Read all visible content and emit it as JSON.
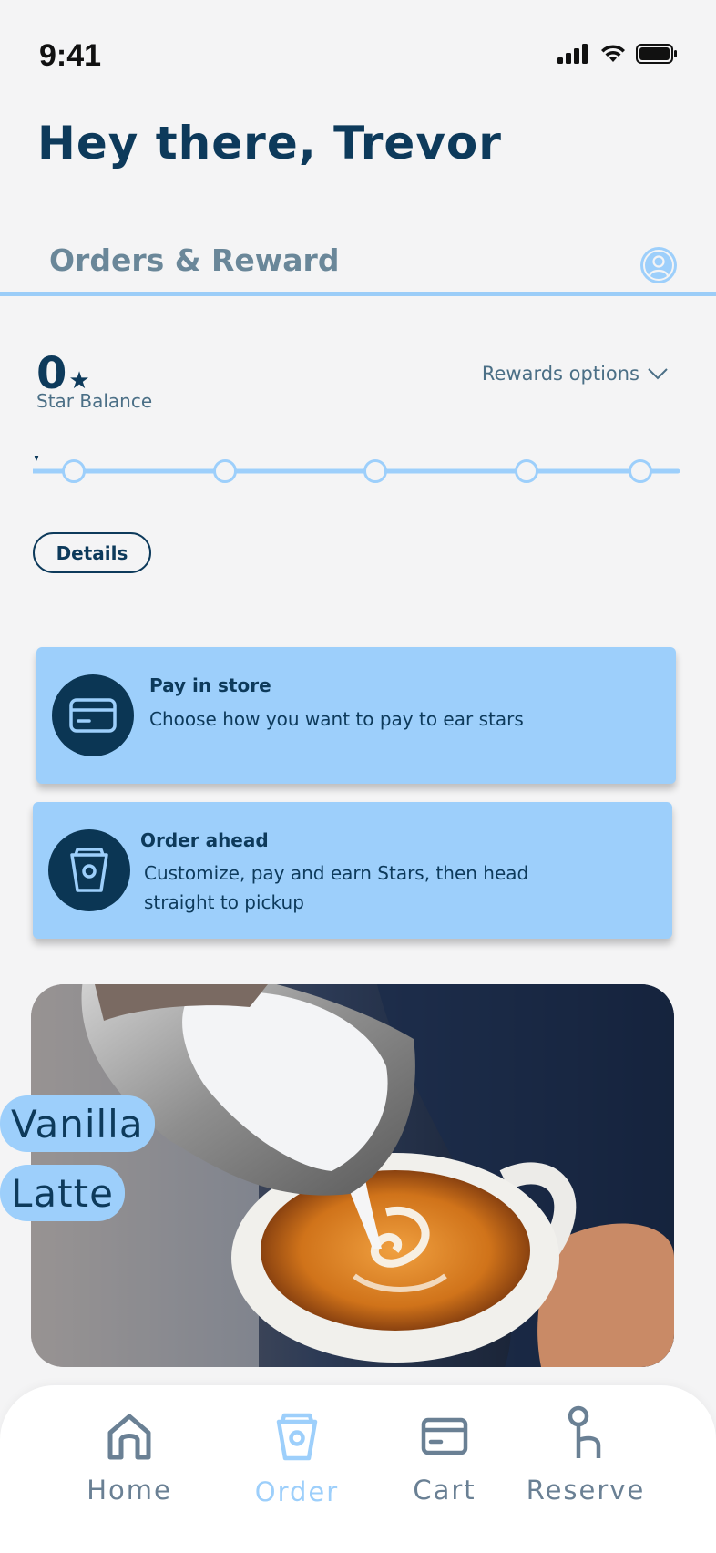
{
  "status_bar": {
    "time": "9:41"
  },
  "header": {
    "greeting": "Hey there, Trevor"
  },
  "section": {
    "title": "Orders & Reward"
  },
  "rewards": {
    "star_count": "0",
    "star_symbol": "★",
    "star_label": "Star Balance",
    "options_label": "Rewards options",
    "progress_fraction": 0,
    "milestones": 5,
    "details_label": "Details"
  },
  "cards": [
    {
      "title": "Pay in store",
      "description": "Choose how you want to pay to ear stars",
      "icon": "credit-card-icon"
    },
    {
      "title": "Order ahead",
      "description_line1": "Customize, pay and earn Stars, then head",
      "description_line2": "straight to pickup",
      "icon": "cup-icon"
    }
  ],
  "promo": {
    "line1": "Vanilla",
    "line2": "Latte"
  },
  "tabbar": {
    "items": [
      {
        "label": "Home",
        "icon": "home-icon",
        "active": false
      },
      {
        "label": "Order",
        "icon": "cup-icon",
        "active": true
      },
      {
        "label": "Cart",
        "icon": "credit-card-icon",
        "active": false
      },
      {
        "label": "Reserve",
        "icon": "key-icon",
        "active": false
      }
    ]
  },
  "colors": {
    "primary": "#0d3a5b",
    "accent": "#9dcffb",
    "muted": "#6a8094",
    "background": "#f4f4f5"
  }
}
